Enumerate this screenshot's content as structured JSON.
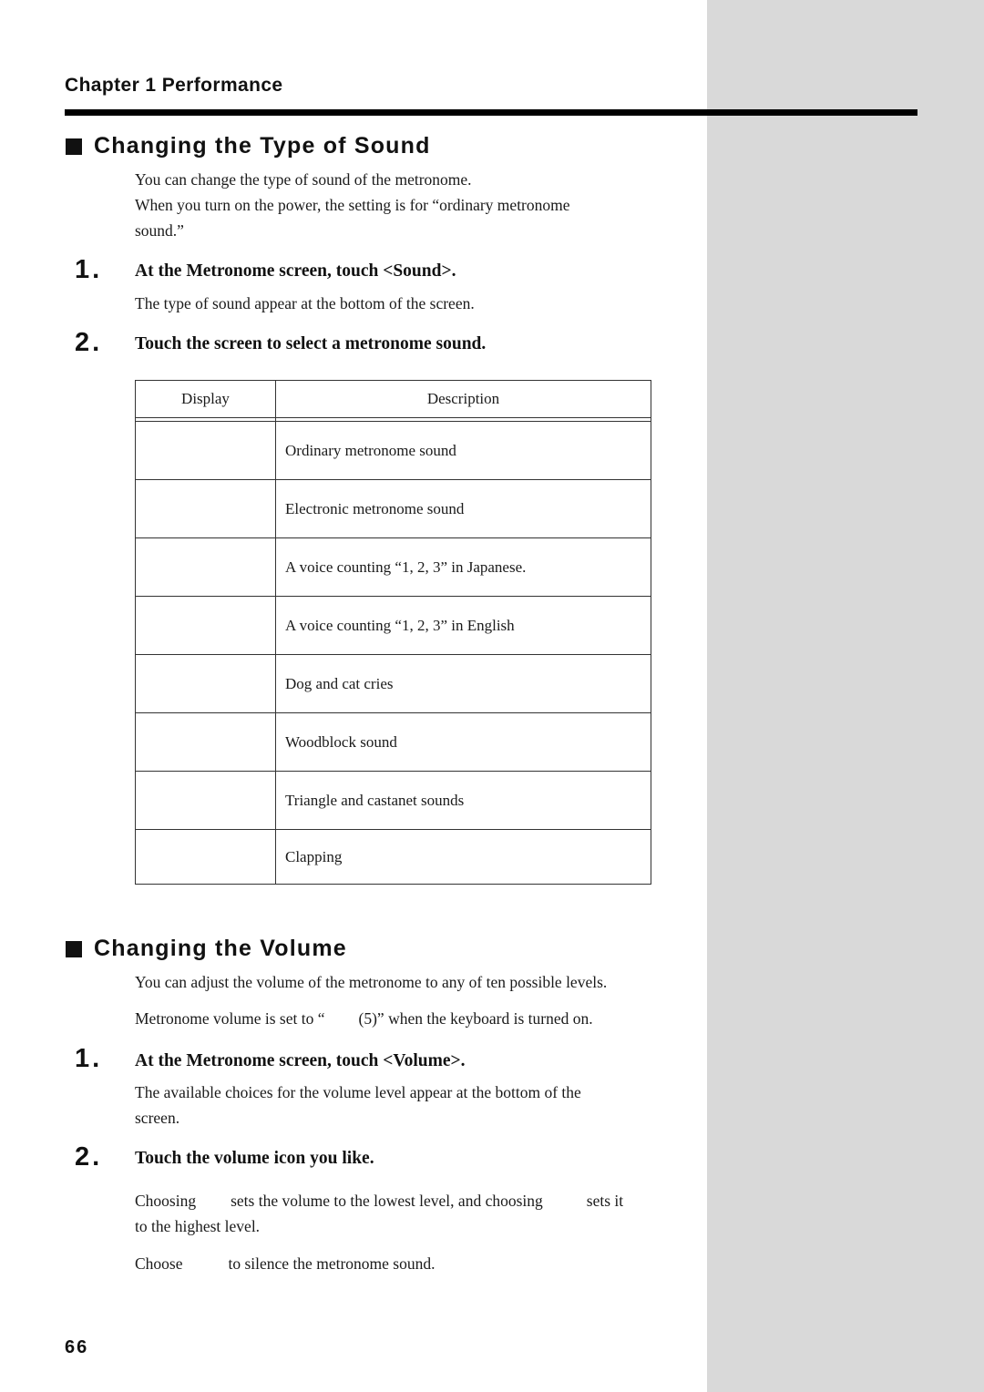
{
  "header": {
    "chapter": "Chapter 1 Performance"
  },
  "section_sound": {
    "title": "Changing the Type of Sound",
    "intro": [
      "You can change the type of sound of the metronome.",
      "When you turn on the power, the setting is for “ordinary metronome",
      "sound.”"
    ],
    "steps": [
      {
        "number": "1.",
        "title": "At the Metronome screen, touch <Sound>.",
        "text": "The type of sound appear at the bottom of the screen."
      },
      {
        "number": "2.",
        "title": "Touch the screen to select a metronome sound."
      }
    ],
    "table": {
      "headers": [
        "Display",
        "Description"
      ],
      "rows": [
        {
          "display": "",
          "description": "Ordinary metronome sound"
        },
        {
          "display": "",
          "description": "Electronic metronome sound"
        },
        {
          "display": "",
          "description": "A voice counting “1, 2, 3” in Japanese."
        },
        {
          "display": "",
          "description": "A voice counting “1, 2, 3” in English"
        },
        {
          "display": "",
          "description": "Dog and cat cries"
        },
        {
          "display": "",
          "description": "Woodblock sound"
        },
        {
          "display": "",
          "description": "Triangle and castanet sounds"
        },
        {
          "display": "",
          "description": "Clapping"
        }
      ]
    }
  },
  "section_volume": {
    "title": "Changing the Volume",
    "intro": "You can adjust the volume of the metronome to any of ten possible levels.",
    "default_note_prefix": "Metronome volume is set to “",
    "default_note_suffix": "(5)” when the keyboard is turned on.",
    "steps": [
      {
        "number": "1.",
        "title": "At the Metronome screen, touch <Volume>.",
        "text_line1": "The available choices for the volume level appear at the bottom of the",
        "text_line2": "screen."
      },
      {
        "number": "2.",
        "title": "Touch the volume icon you like.",
        "text_part1": "Choosing",
        "text_part2": "sets the volume to the lowest level, and choosing",
        "text_part3": "sets it",
        "text_line2": "to the highest level.",
        "mute_part1": "Choose",
        "mute_part2": "to silence the metronome sound."
      }
    ]
  },
  "footer": {
    "page_number": "66"
  }
}
